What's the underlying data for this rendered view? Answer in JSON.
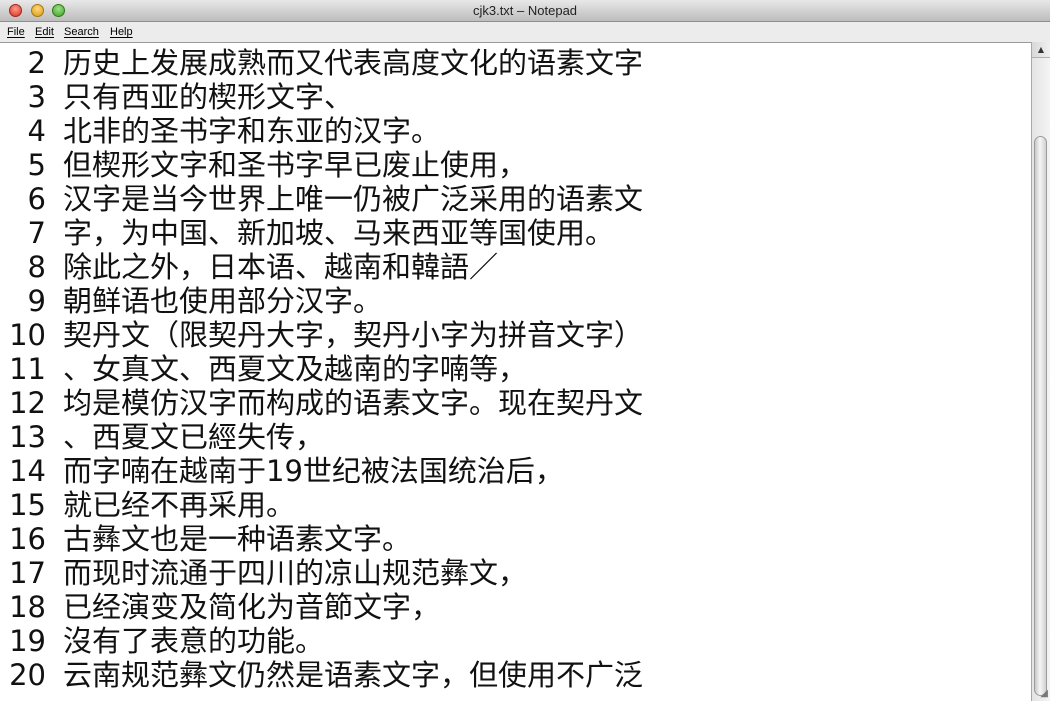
{
  "window": {
    "title": "cjk3.txt – Notepad"
  },
  "menu": {
    "file": "File",
    "edit": "Edit",
    "search": "Search",
    "help": "Help"
  },
  "editor": {
    "lines": [
      {
        "number": "2",
        "text": "历史上发展成熟而又代表高度文化的语素文字"
      },
      {
        "number": "3",
        "text": "只有西亚的楔形文字、"
      },
      {
        "number": "4",
        "text": "北非的圣书字和东亚的汉字。"
      },
      {
        "number": "5",
        "text": "但楔形文字和圣书字早已废止使用，"
      },
      {
        "number": "6",
        "text": "汉字是当今世界上唯一仍被广泛采用的语素文"
      },
      {
        "number": "7",
        "text": "字，为中国、新加坡、马来西亚等国使用。"
      },
      {
        "number": "8",
        "text": "除此之外，日本语、越南和韓語／"
      },
      {
        "number": "9",
        "text": "朝鲜语也使用部分汉字。"
      },
      {
        "number": "10",
        "text": "契丹文（限契丹大字，契丹小字为拼音文字）"
      },
      {
        "number": "11",
        "text": "、女真文、西夏文及越南的字喃等，"
      },
      {
        "number": "12",
        "text": "均是模仿汉字而构成的语素文字。现在契丹文"
      },
      {
        "number": "13",
        "text": "、西夏文已經失传，"
      },
      {
        "number": "14",
        "text": "而字喃在越南于19世纪被法国统治后，"
      },
      {
        "number": "15",
        "text": "就已经不再采用。"
      },
      {
        "number": "16",
        "text": "古彝文也是一种语素文字。"
      },
      {
        "number": "17",
        "text": "而现时流通于四川的凉山规范彝文，"
      },
      {
        "number": "18",
        "text": "已经演变及简化为音節文字，"
      },
      {
        "number": "19",
        "text": "沒有了表意的功能。"
      },
      {
        "number": "20",
        "text": "云南规范彝文仍然是语素文字，但使用不广泛"
      }
    ]
  },
  "icons": {
    "scroll_up": "▲",
    "resize": "◢"
  },
  "colors": {
    "close": "#d4301e",
    "minimize": "#d89a12",
    "zoom": "#3f9e25"
  }
}
